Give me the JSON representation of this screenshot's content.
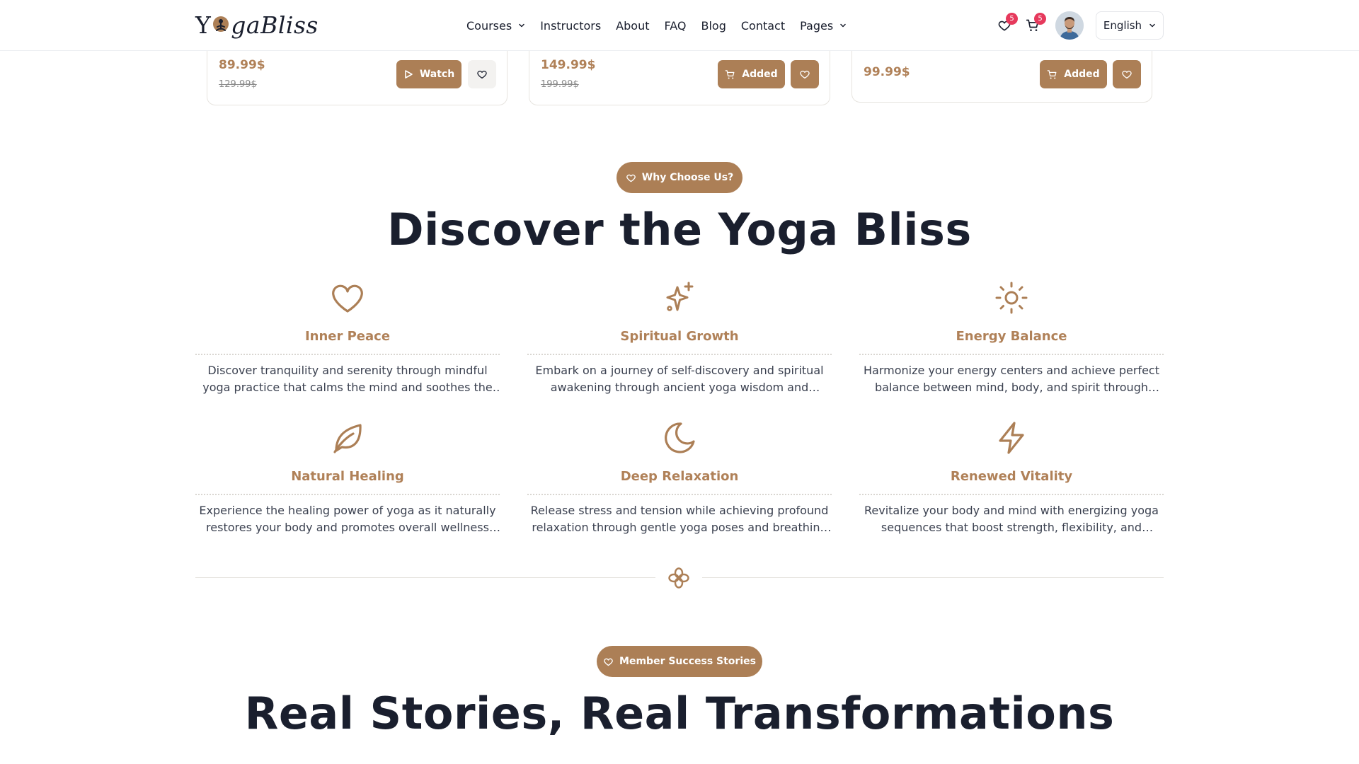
{
  "header": {
    "logo": {
      "part1": "Y",
      "part2": "gaBliss"
    },
    "nav": [
      {
        "label": "Courses",
        "has_dropdown": true
      },
      {
        "label": "Instructors",
        "has_dropdown": false
      },
      {
        "label": "About",
        "has_dropdown": false
      },
      {
        "label": "FAQ",
        "has_dropdown": false
      },
      {
        "label": "Blog",
        "has_dropdown": false
      },
      {
        "label": "Contact",
        "has_dropdown": false
      },
      {
        "label": "Pages",
        "has_dropdown": true
      }
    ],
    "wishlist_count": "5",
    "cart_count": "5",
    "language": "English"
  },
  "courses": [
    {
      "price": "89.99$",
      "old_price": "129.99$",
      "action_label": "Watch",
      "action_icon": "play-icon",
      "favorited": false
    },
    {
      "price": "149.99$",
      "old_price": "199.99$",
      "action_label": "Added",
      "action_icon": "cart-icon",
      "favorited": true
    },
    {
      "price": "99.99$",
      "old_price": "",
      "action_label": "Added",
      "action_icon": "cart-icon",
      "favorited": true
    }
  ],
  "why": {
    "pill_label": "Why Choose Us?",
    "title": "Discover the Yoga Bliss",
    "features": [
      {
        "icon": "heart-icon",
        "name": "Inner Peace",
        "desc": "Discover tranquility and serenity through mindful yoga practice that calms the mind and soothes the soul."
      },
      {
        "icon": "sparkles-icon",
        "name": "Spiritual Growth",
        "desc": "Embark on a journey of self-discovery and spiritual awakening through ancient yoga wisdom and meditation."
      },
      {
        "icon": "sun-icon",
        "name": "Energy Balance",
        "desc": "Harmonize your energy centers and achieve perfect balance between mind, body, and spirit through dedicated practice."
      },
      {
        "icon": "leaf-icon",
        "name": "Natural Healing",
        "desc": "Experience the healing power of yoga as it naturally restores your body and promotes overall wellness and vitality."
      },
      {
        "icon": "moon-icon",
        "name": "Deep Relaxation",
        "desc": "Release stress and tension while achieving profound relaxation through gentle yoga poses and breathing exercises."
      },
      {
        "icon": "zap-icon",
        "name": "Renewed Vitality",
        "desc": "Revitalize your body and mind with energizing yoga sequences that boost strength, flexibility, and mental clarity."
      }
    ]
  },
  "stories": {
    "pill_label": "Member Success Stories",
    "title": "Real Stories, Real Transformations"
  },
  "colors": {
    "accent": "#ac7f56",
    "accent_text": "#b08158",
    "heading": "#1a1f2e",
    "badge": "#e6395c"
  }
}
